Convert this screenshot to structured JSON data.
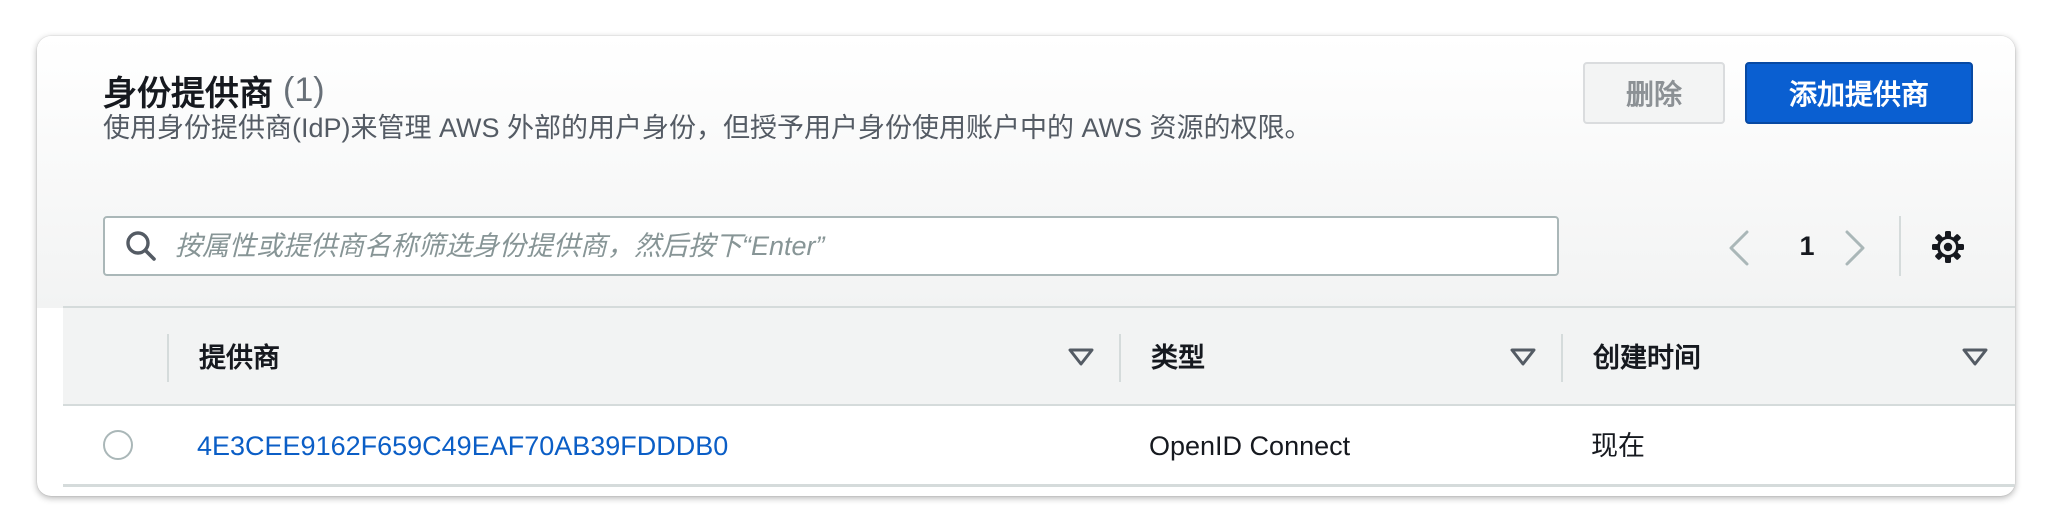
{
  "header": {
    "title": "身份提供商",
    "count": "(1)",
    "description": "使用身份提供商(IdP)来管理 AWS 外部的用户身份，但授予用户身份使用账户中的 AWS 资源的权限。"
  },
  "actions": {
    "delete_label": "删除",
    "add_label": "添加提供商"
  },
  "search": {
    "placeholder": "按属性或提供商名称筛选身份提供商，然后按下“Enter”",
    "value": ""
  },
  "pagination": {
    "current_page": "1"
  },
  "table": {
    "columns": [
      {
        "label": "提供商"
      },
      {
        "label": "类型"
      },
      {
        "label": "创建时间"
      }
    ],
    "rows": [
      {
        "provider": "4E3CEE9162F659C49EAF70AB39FDDDB0",
        "type": "OpenID Connect",
        "created": "现在",
        "selected": false
      }
    ]
  },
  "icons": {
    "search": "search-icon",
    "prev": "chevron-left-icon",
    "next": "chevron-right-icon",
    "settings": "gear-icon",
    "sort": "caret-down-icon"
  },
  "colors": {
    "primary": "#0a5fd1",
    "link": "#0b5ec6",
    "text": "#16191f",
    "secondary_text": "#545b64",
    "border": "#d5dbdb"
  }
}
